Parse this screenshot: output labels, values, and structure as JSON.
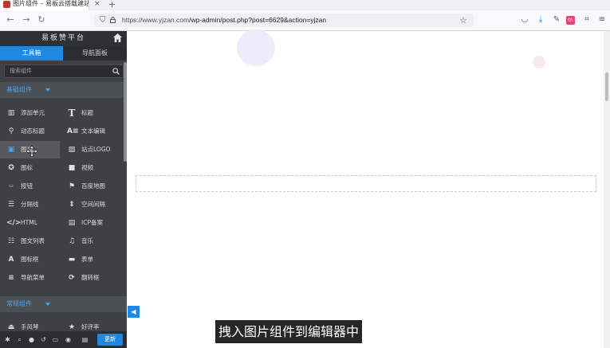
{
  "browser": {
    "tab_title": "图片组件 – 易板云搭载建站",
    "tab_close": "×",
    "new_tab": "+",
    "url_host": "https://www.yjzan.com",
    "url_path": "/wp-admin/post.php?post=6629&action=yjzan"
  },
  "editor": {
    "title": "易板赞平台",
    "tabs": [
      {
        "label": "工具箱"
      },
      {
        "label": "导航面板"
      }
    ],
    "search_placeholder": "搜索组件",
    "sections": {
      "basic": "基础组件",
      "common": "常规组件"
    },
    "widgets": [
      {
        "label": "添加单元",
        "icon": "columns-icon"
      },
      {
        "label": "标题",
        "icon": "heading-icon"
      },
      {
        "label": "动态标题",
        "icon": "animated-heading-icon"
      },
      {
        "label": "文本编辑",
        "icon": "text-editor-icon"
      },
      {
        "label": "图片",
        "icon": "image-icon"
      },
      {
        "label": "站点LOGO",
        "icon": "site-logo-icon"
      },
      {
        "label": "图标",
        "icon": "icon-widget-icon"
      },
      {
        "label": "视频",
        "icon": "video-icon"
      },
      {
        "label": "按钮",
        "icon": "button-icon"
      },
      {
        "label": "百度地图",
        "icon": "map-pin-icon"
      },
      {
        "label": "分隔线",
        "icon": "divider-icon"
      },
      {
        "label": "空间间隔",
        "icon": "spacer-icon"
      },
      {
        "label": "HTML",
        "icon": "code-icon"
      },
      {
        "label": "ICP备案",
        "icon": "icp-card-icon"
      },
      {
        "label": "图文列表",
        "icon": "icon-list-icon"
      },
      {
        "label": "音乐",
        "icon": "music-icon"
      },
      {
        "label": "图标框",
        "icon": "icon-box-icon"
      },
      {
        "label": "表单",
        "icon": "form-icon"
      },
      {
        "label": "导航菜单",
        "icon": "nav-menu-icon"
      },
      {
        "label": "翻转框",
        "icon": "flip-box-icon"
      }
    ],
    "common_widgets": [
      {
        "label": "手风琴",
        "icon": "accordion-icon"
      },
      {
        "label": "好评率",
        "icon": "rating-icon"
      }
    ],
    "update_label": "更新",
    "collapse_glyph": "◀"
  },
  "subtitle": "拽入图片组件到编辑器中",
  "colors": {
    "accent": "#1e88e5",
    "sidebar_bg": "#3d4145",
    "section_label": "#4aa3f0"
  }
}
